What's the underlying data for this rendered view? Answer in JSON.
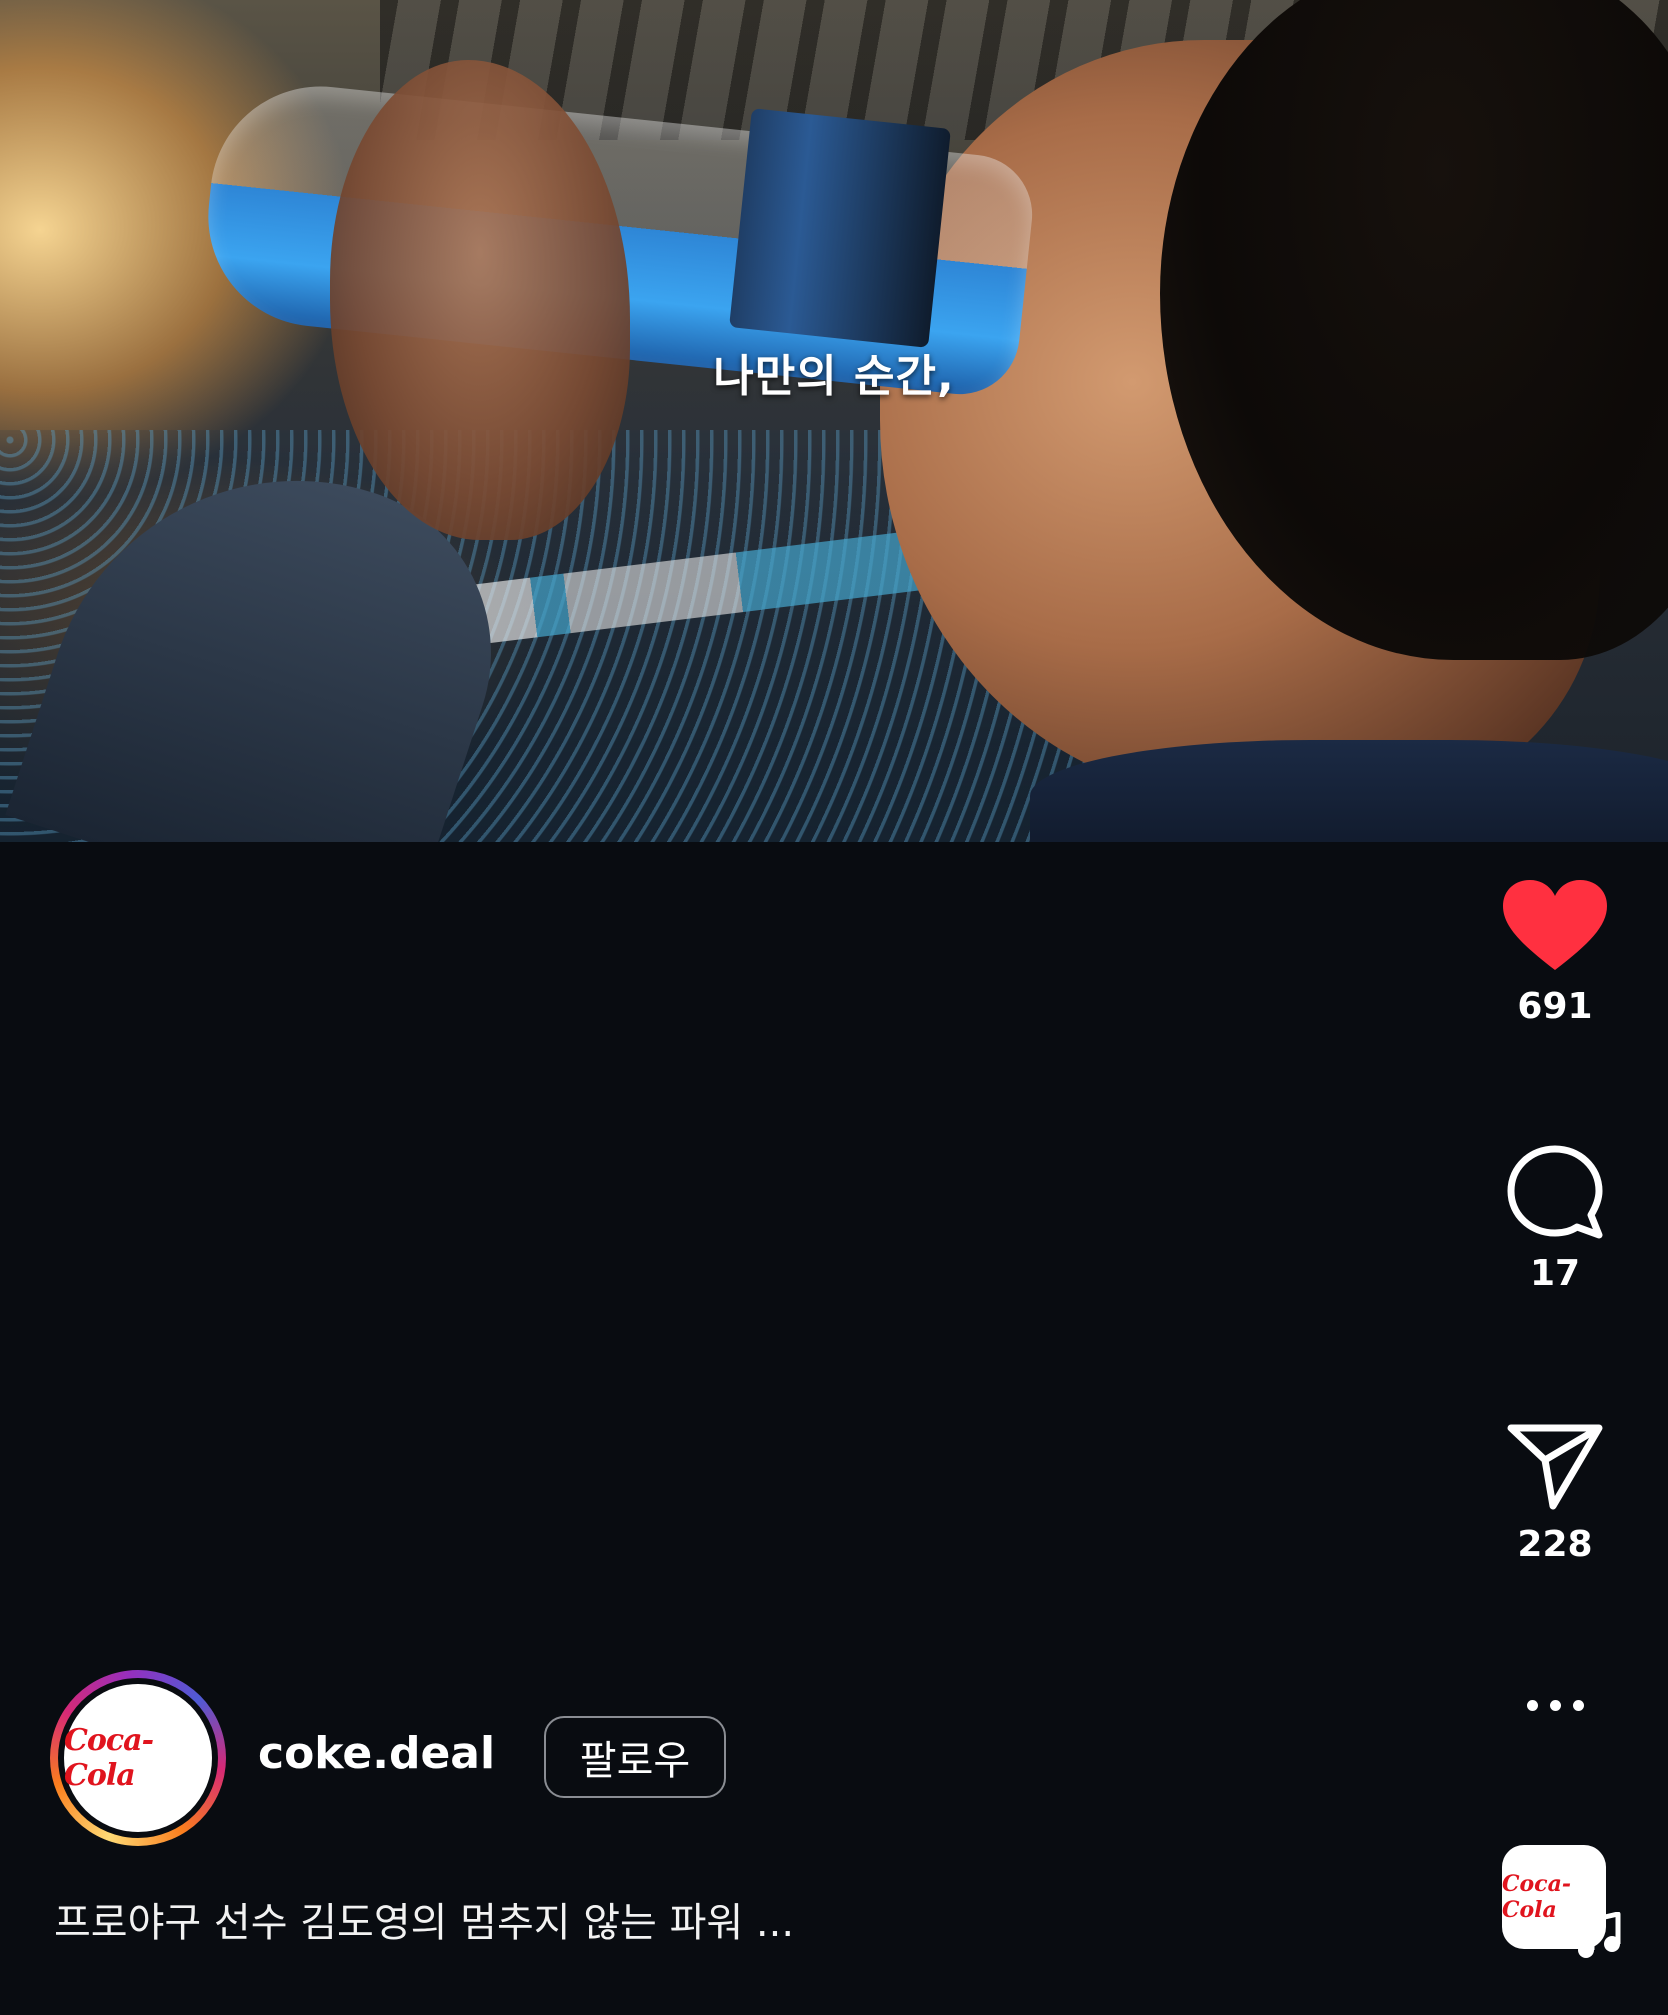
{
  "video": {
    "subtitle": "나만의 순간,"
  },
  "actions": {
    "like": {
      "icon": "heart-filled-icon",
      "count": "691",
      "color": "#ff3040",
      "active": true
    },
    "comment": {
      "icon": "comment-icon",
      "count": "17"
    },
    "share": {
      "icon": "send-icon",
      "count": "228"
    },
    "more": {
      "icon": "more-dots-icon"
    },
    "audio": {
      "icon": "music-note-icon",
      "thumb_label": "Coca-Cola"
    }
  },
  "author": {
    "avatar_label": "Coca-Cola",
    "username": "coke.deal",
    "follow_label": "팔로우"
  },
  "caption": {
    "text": "프로야구 선수 김도영의 멈추지 않는 파워 ..."
  },
  "colors": {
    "background": "#090c11",
    "like_active": "#ff3040",
    "brand_red": "#e0141e"
  }
}
